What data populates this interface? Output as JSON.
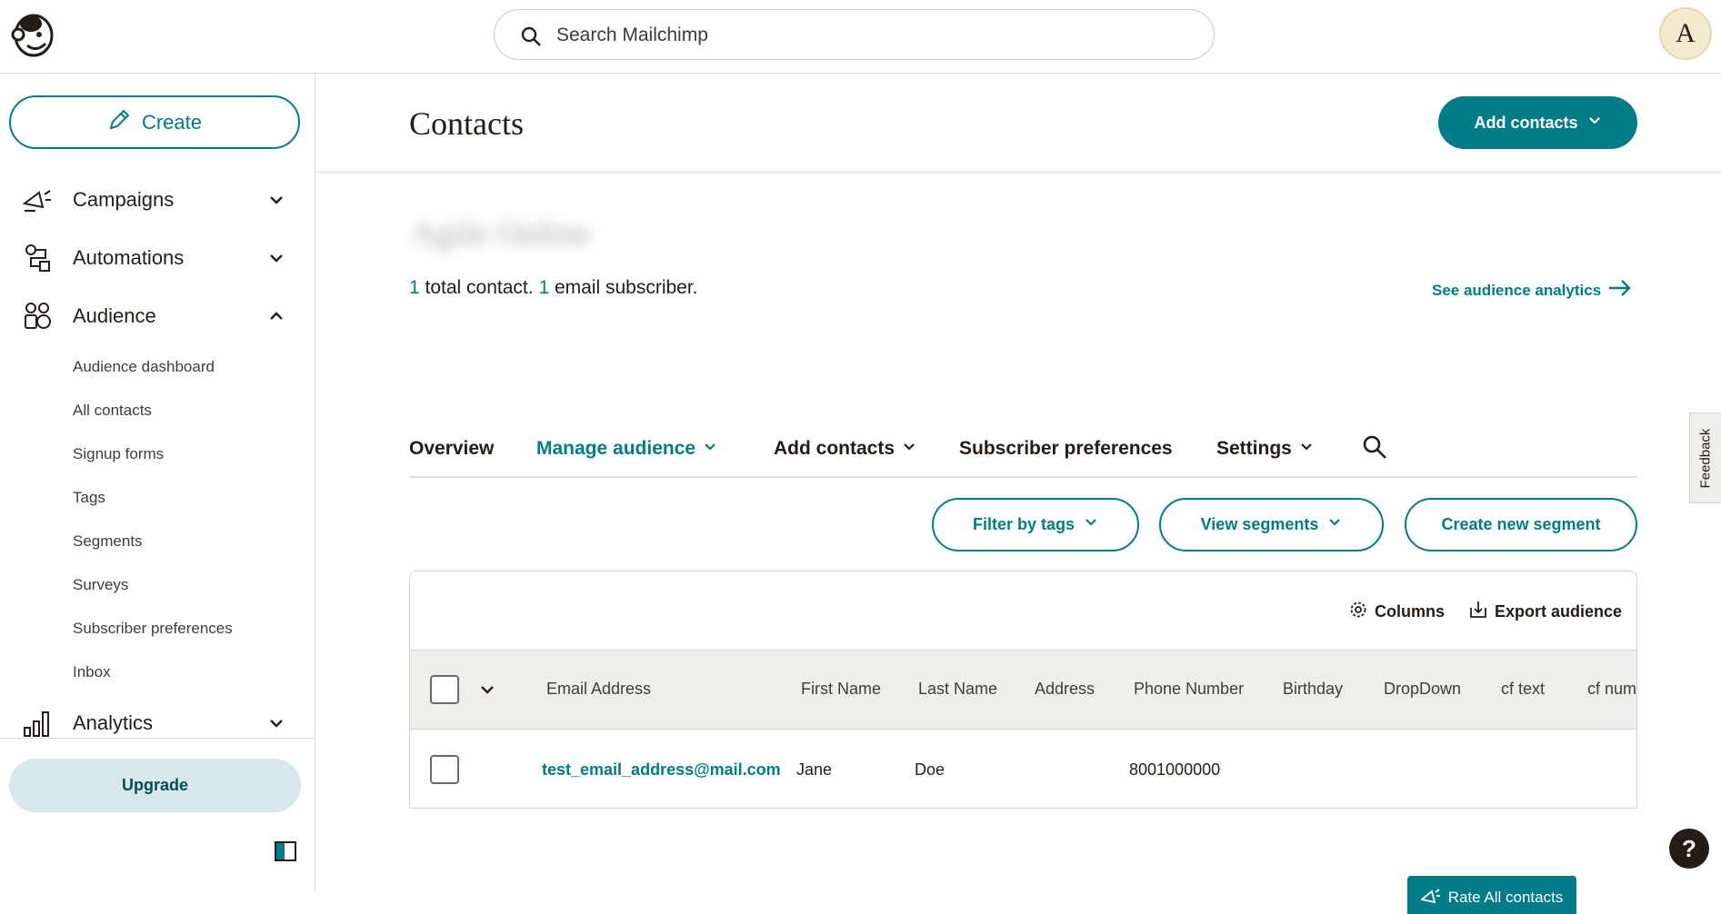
{
  "search": {
    "placeholder": "Search Mailchimp"
  },
  "avatar": {
    "initial": "A"
  },
  "sidebar": {
    "create_label": "Create",
    "nav": [
      {
        "label": "Campaigns",
        "icon": "megaphone-icon"
      },
      {
        "label": "Automations",
        "icon": "automation-flow-icon"
      },
      {
        "label": "Audience",
        "icon": "audience-icon"
      },
      {
        "label": "Analytics",
        "icon": "bar-chart-icon"
      }
    ],
    "audience_items": [
      "Audience dashboard",
      "All contacts",
      "Signup forms",
      "Tags",
      "Segments",
      "Surveys",
      "Subscriber preferences",
      "Inbox"
    ],
    "upgrade_label": "Upgrade"
  },
  "header": {
    "title": "Contacts",
    "add_contacts_label": "Add contacts"
  },
  "audience": {
    "name": "Agile Online",
    "total_count": "1",
    "total_text": " total contact. ",
    "subscriber_count": "1",
    "subscriber_text": " email subscriber.",
    "analytics_link": "See audience analytics"
  },
  "tabs": [
    {
      "label": "Overview"
    },
    {
      "label": "Manage audience"
    },
    {
      "label": "Add contacts"
    },
    {
      "label": "Subscriber preferences"
    },
    {
      "label": "Settings"
    }
  ],
  "filters": {
    "filter_tags": "Filter by tags",
    "view_segments": "View segments",
    "create_segment": "Create new segment"
  },
  "table": {
    "columns_label": "Columns",
    "export_label": "Export audience",
    "headers": [
      "Email Address",
      "First Name",
      "Last Name",
      "Address",
      "Phone Number",
      "Birthday",
      "DropDown",
      "cf text",
      "cf num"
    ],
    "rows": [
      {
        "email": "test_email_address@mail.com",
        "first_name": "Jane",
        "last_name": "Doe",
        "address": "",
        "phone": "8001000000"
      }
    ]
  },
  "feedback_label": "Feedback",
  "help_label": "?",
  "rate_label": "Rate All contacts",
  "colors": {
    "accent": "#007c89",
    "upgrade_bg": "#d8e7e9",
    "table_header_bg": "#efeeea"
  }
}
